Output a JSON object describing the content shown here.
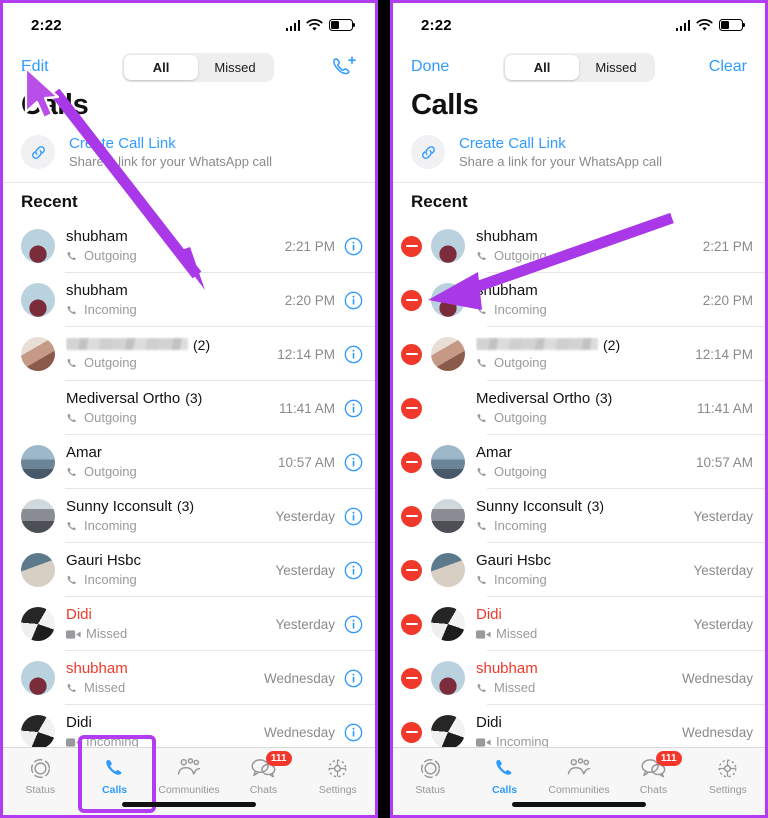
{
  "status_bar": {
    "time": "2:22",
    "battery_level": "42",
    "wifi": "wifi-icon",
    "signal": "signal-icon"
  },
  "panels": [
    {
      "id": "left",
      "mode": "browse",
      "nav": {
        "left_action": "Edit",
        "right_action": "",
        "right_icon": "new-call-icon"
      },
      "segmented": {
        "options": [
          "All",
          "Missed"
        ],
        "selected": "All"
      },
      "title": "Calls",
      "call_link": {
        "title": "Create Call Link",
        "subtitle": "Share a link for your WhatsApp call",
        "icon": "link-icon"
      },
      "section_header": "Recent"
    },
    {
      "id": "right",
      "mode": "edit",
      "nav": {
        "left_action": "Done",
        "right_action": "Clear",
        "right_icon": ""
      },
      "segmented": {
        "options": [
          "All",
          "Missed"
        ],
        "selected": "All"
      },
      "title": "Calls",
      "call_link": {
        "title": "Create Call Link",
        "subtitle": "Share a link for your WhatsApp call",
        "icon": "link-icon"
      },
      "section_header": "Recent"
    }
  ],
  "calls": [
    {
      "name": "shubham",
      "count": "",
      "direction": "Outgoing",
      "kind": "voice",
      "time": "2:21 PM",
      "missed": false,
      "redacted": false,
      "avatar": "photo-man"
    },
    {
      "name": "shubham",
      "count": "",
      "direction": "Incoming",
      "kind": "voice",
      "time": "2:20 PM",
      "missed": false,
      "redacted": false,
      "avatar": "photo-man"
    },
    {
      "name": "",
      "count": "(2)",
      "direction": "Outgoing",
      "kind": "voice",
      "time": "12:14 PM",
      "missed": false,
      "redacted": true,
      "avatar": "photo-group"
    },
    {
      "name": "Mediversal Ortho",
      "count": "(3)",
      "direction": "Outgoing",
      "kind": "voice",
      "time": "11:41 AM",
      "missed": false,
      "redacted": false,
      "avatar": "logo-light"
    },
    {
      "name": "Amar",
      "count": "",
      "direction": "Outgoing",
      "kind": "voice",
      "time": "10:57 AM",
      "missed": false,
      "redacted": false,
      "avatar": "photo-scene"
    },
    {
      "name": "Sunny Icconsult",
      "count": "(3)",
      "direction": "Incoming",
      "kind": "voice",
      "time": "Yesterday",
      "missed": false,
      "redacted": false,
      "avatar": "photo-crowd"
    },
    {
      "name": "Gauri Hsbc",
      "count": "",
      "direction": "Incoming",
      "kind": "voice",
      "time": "Yesterday",
      "missed": false,
      "redacted": false,
      "avatar": "photo-person"
    },
    {
      "name": "Didi",
      "count": "",
      "direction": "Missed",
      "kind": "video",
      "time": "Yesterday",
      "missed": true,
      "redacted": false,
      "avatar": "photo-bw"
    },
    {
      "name": "shubham",
      "count": "",
      "direction": "Missed",
      "kind": "voice",
      "time": "Wednesday",
      "missed": true,
      "redacted": false,
      "avatar": "photo-man"
    },
    {
      "name": "Didi",
      "count": "",
      "direction": "Incoming",
      "kind": "video",
      "time": "Wednesday",
      "missed": false,
      "redacted": false,
      "avatar": "photo-bw"
    }
  ],
  "tabbar": {
    "tabs": [
      {
        "label": "Status",
        "icon": "status-rings-icon",
        "active": false,
        "badge": ""
      },
      {
        "label": "Calls",
        "icon": "phone-icon",
        "active": true,
        "badge": ""
      },
      {
        "label": "Communities",
        "icon": "communities-icon",
        "active": false,
        "badge": ""
      },
      {
        "label": "Chats",
        "icon": "chats-icon",
        "active": false,
        "badge": "111"
      },
      {
        "label": "Settings",
        "icon": "gear-icon",
        "active": false,
        "badge": ""
      }
    ]
  },
  "colors": {
    "accent_blue": "#2f9bff",
    "missed_red": "#f0392b",
    "highlight_purple": "#b23df0",
    "muted_gray": "#8a8a8e"
  }
}
